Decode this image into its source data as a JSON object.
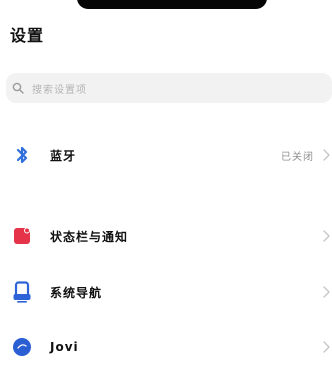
{
  "header": {
    "title": "设置"
  },
  "search": {
    "placeholder": "搜索设置项",
    "icon": "search-icon"
  },
  "rows": [
    {
      "label": "蓝牙",
      "value": "已关闭",
      "icon": "bluetooth-icon",
      "icon_color": "#2f6fdc"
    },
    {
      "label": "状态栏与通知",
      "value": "",
      "icon": "notification-icon",
      "icon_color": "#e5344a"
    },
    {
      "label": "系统导航",
      "value": "",
      "icon": "navigation-icon",
      "icon_color": "#2f63d8"
    },
    {
      "label": "Jovi",
      "value": "",
      "icon": "jovi-icon",
      "icon_color": "#2a5fd4"
    }
  ],
  "colors": {
    "background": "#ffffff",
    "search_bg": "#f2f2f2",
    "text_primary": "#111111",
    "text_secondary": "#8f8f8f",
    "chevron": "#c7c7c7"
  }
}
